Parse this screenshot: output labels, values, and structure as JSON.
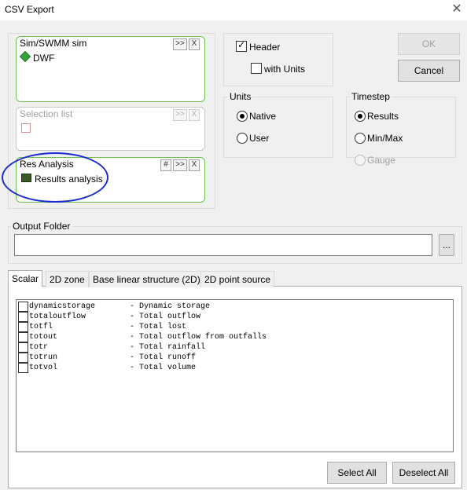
{
  "window": {
    "title": "CSV Export"
  },
  "sources": [
    {
      "header": "Sim/SWMM sim",
      "buttons": [
        ">>",
        "X"
      ],
      "item": "DWF",
      "icon": "green-diamond-icon",
      "enabled": true
    },
    {
      "header": "Selection list",
      "buttons": [
        ">>",
        "X"
      ],
      "item": "",
      "icon": "placeholder-icon",
      "enabled": false
    },
    {
      "header": "Res Analysis",
      "buttons": [
        "#",
        ">>",
        "X"
      ],
      "item": "Results analysis",
      "icon": "results-analysis-icon",
      "enabled": true
    }
  ],
  "header_opts": {
    "header_label": "Header",
    "header_checked": true,
    "units_label": "with Units",
    "units_checked": false
  },
  "buttons": {
    "ok": "OK",
    "cancel": "Cancel",
    "select_all": "Select All",
    "deselect_all": "Deselect All",
    "browse": "..."
  },
  "units": {
    "label": "Units",
    "options": [
      "Native",
      "User"
    ],
    "selected": "Native"
  },
  "timestep": {
    "label": "Timestep",
    "options": [
      "Results",
      "Min/Max",
      "Gauge"
    ],
    "selected": "Results",
    "disabled": [
      "Gauge"
    ]
  },
  "output_folder": {
    "label": "Output Folder",
    "value": ""
  },
  "tabs": [
    "Scalar",
    "2D zone",
    "Base linear structure (2D)",
    "2D point source"
  ],
  "active_tab": "Scalar",
  "variables": [
    {
      "id": "dynamicstorage",
      "desc": "- Dynamic storage"
    },
    {
      "id": "totaloutflow",
      "desc": "- Total outflow"
    },
    {
      "id": "totfl",
      "desc": "- Total lost"
    },
    {
      "id": "totout",
      "desc": "- Total outflow from outfalls"
    },
    {
      "id": "totr",
      "desc": "- Total rainfall"
    },
    {
      "id": "totrun",
      "desc": "- Total runoff"
    },
    {
      "id": "totvol",
      "desc": "- Total volume"
    }
  ],
  "colors": {
    "source_border": "#6cc04a",
    "annotation": "#1a2bd0"
  }
}
